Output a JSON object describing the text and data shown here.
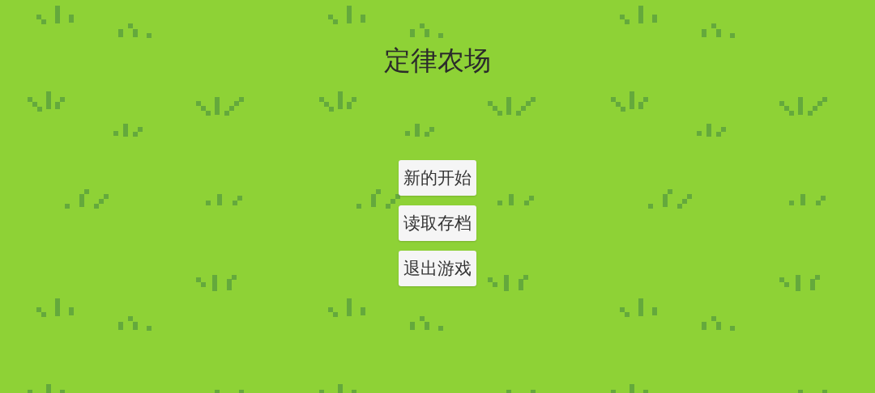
{
  "title": "定律农场",
  "menu": [
    {
      "label": "新的开始"
    },
    {
      "label": "读取存档"
    },
    {
      "label": "退出游戏"
    }
  ]
}
